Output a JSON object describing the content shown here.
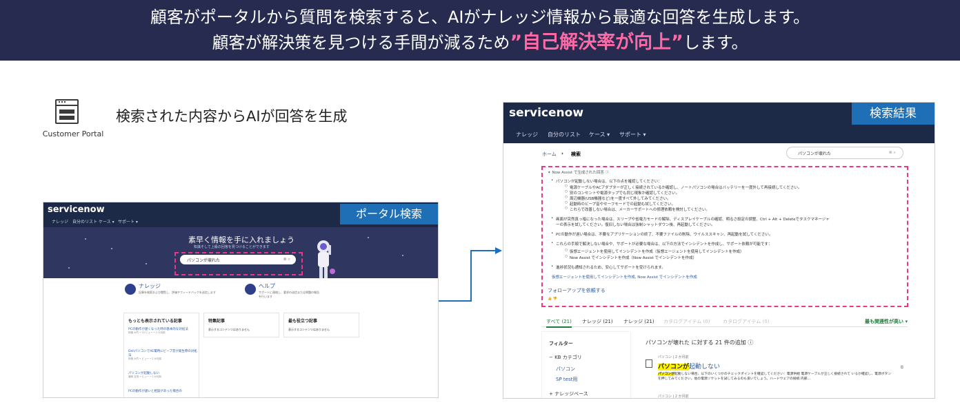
{
  "banner": {
    "line1": "顧客がポータルから質問を検索すると、AIがナレッジ情報から最適な回答を生成します。",
    "line2_pre": "顧客が解決策を見つける手間が減るため",
    "line2_highlight": "”自己解決率が向上”",
    "line2_post": "します。",
    "bg_color": "#262b4f",
    "highlight_color": "#ff6aa6"
  },
  "left_section": {
    "icon": "browser-window-icon",
    "icon_label": "Customer Portal",
    "heading": "検索された内容からAIが回答を生成"
  },
  "portal_shot": {
    "logo": "servicenow",
    "nav": [
      "ナレッジ",
      "自分のリスト",
      "ケース ▾",
      "サポート ▾"
    ],
    "tag": "ポータル検索",
    "hero_title": "素早く情報を手に入れましょう",
    "hero_sub": "知識そして上級の回答を見つけることができます",
    "search_value": "パソコンが壊れた",
    "cards": [
      {
        "title": "ナレッジ",
        "desc": "記事を検索および閲覧し、評価やフィードバックを送信します"
      },
      {
        "title": "ヘルプ",
        "desc": "サポートに連絡し、要求の送信または問題の報告を行います"
      }
    ],
    "lists": [
      {
        "title": "もっとも表示されている記事",
        "items": [
          {
            "t": "PCの動作が遅くなった時の基本的な対処法",
            "m": "評価 大竹 • 33 ビュー • 2 か月前"
          },
          {
            "t": "DellパソコンでAE電時にビープ音が発生際の対処法",
            "m": "評価 大竹 • ビュー • 2 か月前"
          },
          {
            "t": "パソコンが起動しない",
            "m": "通常 吉田 • ビュー • 2 か月前"
          },
          {
            "t": "PCの動作が遅いと相談があった場合の",
            "m": ""
          }
        ]
      },
      {
        "title": "特集記事",
        "empty": "表示するコンテンツはありません"
      },
      {
        "title": "最も役立つ記事",
        "empty": "表示するコンテンツはありません"
      }
    ]
  },
  "result_shot": {
    "logo": "servicenow",
    "nav": [
      "ナレッジ",
      "自分のリスト",
      "ケース ▾",
      "サポート ▾"
    ],
    "tag": "検索結果",
    "breadcrumb_home": "ホーム",
    "breadcrumb_sep": "›",
    "breadcrumb_current": "検索",
    "search_value": "パソコンが壊れた",
    "now_assist_label": "✦ Now Assist で生成された回答 ⓘ",
    "answer": {
      "b1": "パソコンが起動しない場合は、以下の点を確認してください：",
      "b1_subs": [
        "電源ケーブルやACアダプターが正しく接続されているか確認し、ノートパソコンの場合はバッテリーを一度外して再接続してください。",
        "別のコンセントや電源タップでも同じ現象か確認してください。",
        "周辺機器(USB機器など)を一度すべて外してみてください。",
        "起動時のビープ音やセーフモードでの起動も試してください。",
        "これらで改善しない場合は、メーカーサポートへの修理依頼を検討してください。"
      ],
      "b2_l1": "画面が突然真っ暗になった場合は、スリープや省電力モードの解除、ディスプレイケーブルの確認、明るさ設定の調整、Ctrl + Alt + Deleteでタスクマネージャ",
      "b2_l2": "ーの表示を試してください。復旧しない場合は強制シャットダウン後、再起動してください。",
      "b3": "PCの動作が遅い場合は、不要なアプリケーションの終了、不要ファイルの削除、ウイルススキャン、再起動を試してください。",
      "b4": "これらの手順で解決しない場合や、サポートが必要な場合は、以下の方法でインシデントを作成し、サポート依頼が可能です：",
      "b4_subs": [
        "仮想エージェントを使用してインシデントを作成（仮想エージェントを使用してインシデントを作成）",
        "Now Assist でインシデントを作成（Now Assist でインシデントを作成）"
      ],
      "b5": "進捗状況も通知されるため、安心してサポートを受けられます。",
      "links": "仮想エージェントを使用してインシデントを作成, Now Assist でインシデントを作成"
    },
    "follow_up": "フォローアップを依頼する",
    "tabs": [
      {
        "label": "すべて (21)",
        "state": "active"
      },
      {
        "label": "ナレッジ (21)",
        "state": "normal"
      },
      {
        "label": "ナレッジ (21)",
        "state": "normal"
      },
      {
        "label": "カタログアイテム (0)",
        "state": "dim"
      },
      {
        "label": "カタログアイテム (0)",
        "state": "dim"
      }
    ],
    "sort_label": "最も関連性が高い ▾",
    "filter": {
      "title": "フィルター",
      "kb_category": "− KB カテゴリ",
      "cat1": "パソコン",
      "cat2": "SP test用",
      "kb_base": "+ ナレッジベース"
    },
    "results_header": "パソコンが壊れた に対する 21 件の追加 ⓘ",
    "result1": {
      "meta": "パソコン | 2 か月前",
      "title_mark": "パソコンが",
      "title_rest": "起動しない",
      "body_mark": "パソコンが",
      "body_rest": "起動しない場合、以下のいくつかのチェックポイントを確認してください：電源供給 電源ケーブルが正しく接続されて いるか確認し、電源ボタンを押してみてください。他の電源ソケットを試してみるのも良いでしょう。ハードウェアの接続 内部…"
    },
    "result2_meta": "パソコン | 2 か月前",
    "accent_pink": "#e9378a",
    "accent_blue": "#1f6fb6",
    "accent_green": "#1e7a3a"
  }
}
